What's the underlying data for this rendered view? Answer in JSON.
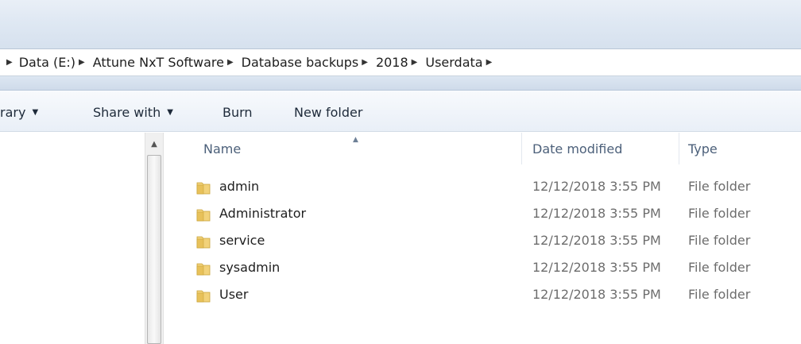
{
  "breadcrumbs": [
    "Data (E:)",
    "Attune NxT Software",
    "Database backups",
    "2018",
    "Userdata"
  ],
  "toolbar": {
    "library_label": "rary",
    "share_label": "Share with",
    "burn_label": "Burn",
    "new_folder_label": "New folder"
  },
  "columns": {
    "name": "Name",
    "date": "Date modified",
    "type": "Type"
  },
  "files": [
    {
      "name": "admin",
      "date": "12/12/2018 3:55 PM",
      "type": "File folder"
    },
    {
      "name": "Administrator",
      "date": "12/12/2018 3:55 PM",
      "type": "File folder"
    },
    {
      "name": "service",
      "date": "12/12/2018 3:55 PM",
      "type": "File folder"
    },
    {
      "name": "sysadmin",
      "date": "12/12/2018 3:55 PM",
      "type": "File folder"
    },
    {
      "name": "User",
      "date": "12/12/2018 3:55 PM",
      "type": "File folder"
    }
  ],
  "icons": {
    "folder": "folder-icon",
    "breadcrumb_separator": "chevron-right-icon",
    "dropdown": "chevron-down-icon",
    "sort": "sort-ascending-icon",
    "scroll_up": "scroll-up-icon"
  },
  "colors": {
    "folder_yellow": "#e8c15a",
    "header_text": "#4c607a",
    "muted_text": "#6d6d6d"
  }
}
